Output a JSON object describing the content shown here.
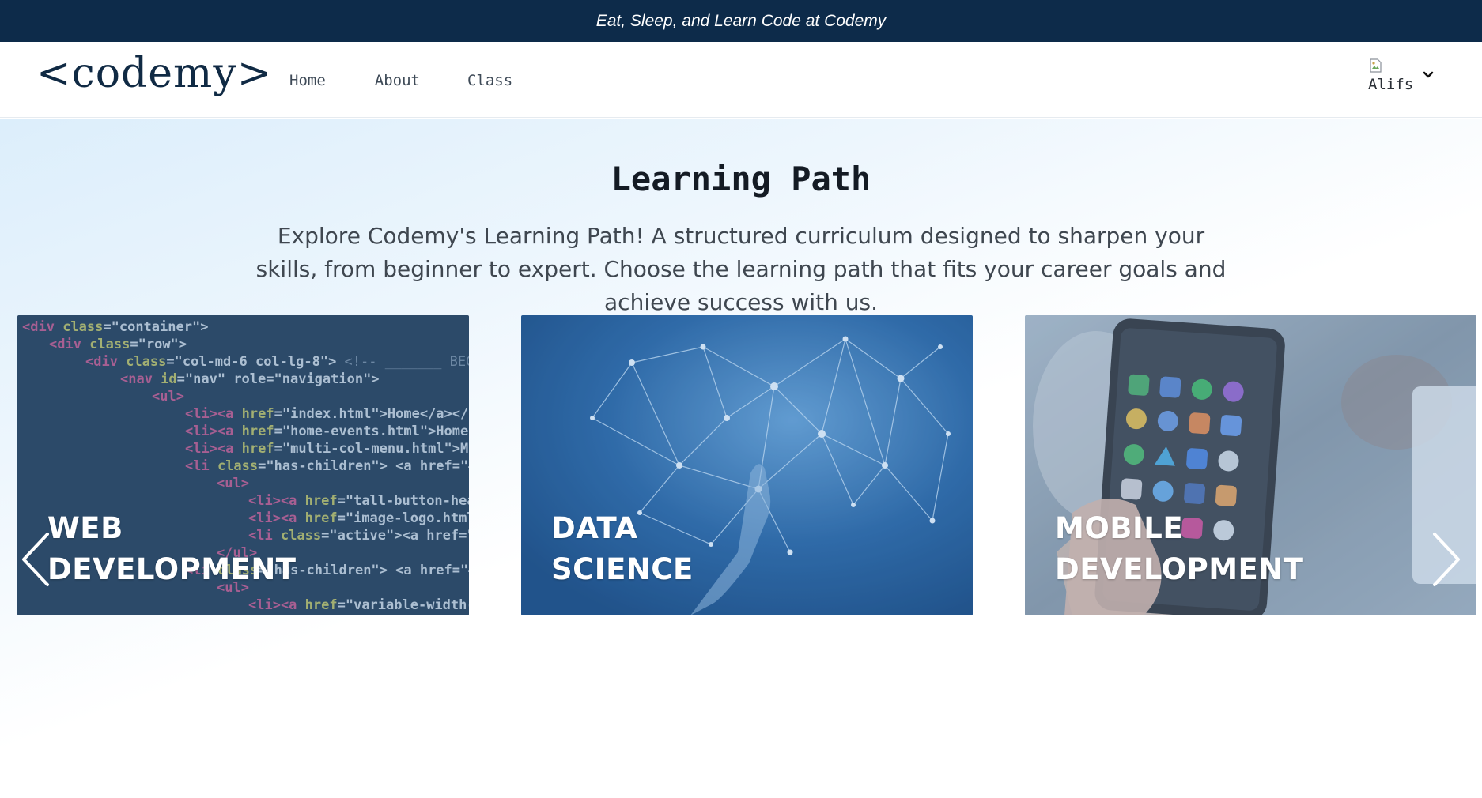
{
  "announcement": "Eat, Sleep, and Learn Code at Codemy",
  "brand": {
    "logo_text": "<codemy>"
  },
  "nav": {
    "items": [
      {
        "label": "Home"
      },
      {
        "label": "About"
      },
      {
        "label": "Class"
      }
    ]
  },
  "user": {
    "avatar_alt": "Alifs",
    "menu_icon": "chevron-down-icon"
  },
  "hero": {
    "title": "Learning Path",
    "description": "Explore Codemy's Learning Path! A structured curriculum designed to sharpen your skills, from beginner to expert. Choose the learning path that fits your career goals and achieve success with us."
  },
  "carousel": {
    "prev_icon": "chevron-left-icon",
    "next_icon": "chevron-right-icon",
    "cards": [
      {
        "title": "WEB\nDEVELOPMENT"
      },
      {
        "title": "DATA\nSCIENCE"
      },
      {
        "title": "MOBILE\nDEVELOPMENT"
      }
    ]
  },
  "colors": {
    "announcement_bg": "#0d2b4a",
    "card_overlay": "#2f6aa6"
  }
}
